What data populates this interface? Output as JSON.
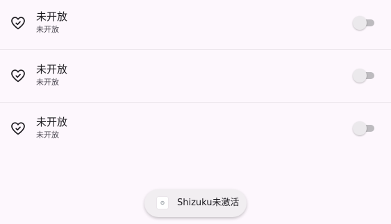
{
  "colors": {
    "background": "#fdf7fd",
    "divider": "#ece6ec",
    "text_primary": "#1d1b20",
    "text_secondary": "#49454f",
    "switch_track": "#bdbbbf",
    "switch_thumb": "#ebe9ec",
    "toast_bg": "#f1eef1"
  },
  "items": [
    {
      "icon": "heart-check-icon",
      "title": "未开放",
      "subtitle": "未开放",
      "enabled": false
    },
    {
      "icon": "heart-check-icon",
      "title": "未开放",
      "subtitle": "未开放",
      "enabled": false
    },
    {
      "icon": "heart-check-icon",
      "title": "未开放",
      "subtitle": "未开放",
      "enabled": false
    }
  ],
  "toast": {
    "icon": "app-icon",
    "text": "Shizuku未激活"
  }
}
